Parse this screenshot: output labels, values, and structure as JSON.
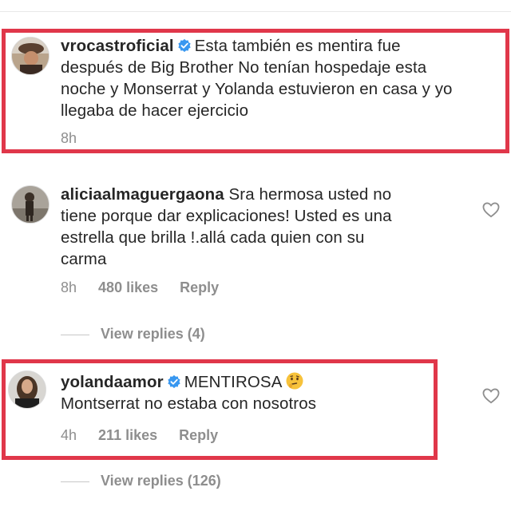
{
  "comments": [
    {
      "username": "vrocastroficial",
      "verified": true,
      "text": "Esta también es mentira fue después de Big Brother No tenían hospedaje esta noche y Monserrat y Yolanda estuvieron en casa y yo llegaba de hacer ejercicio",
      "lines": [
        "Esta también es mentira fue",
        "después de Big Brother No tenían hospedaje esta",
        "noche y Monserrat y Yolanda estuvieron en casa y yo",
        "llegaba de hacer ejercicio"
      ],
      "time": "8h",
      "highlighted": true
    },
    {
      "username": "aliciaalmaguergaona",
      "verified": false,
      "lines": [
        "Sra hermosa usted no",
        "tiene porque dar explicaciones! Usted es una",
        "estrella que brilla !.allá cada quien con su",
        "carma"
      ],
      "time": "8h",
      "likes": "480 likes",
      "reply": "Reply",
      "view_replies": "View replies (4)",
      "highlighted": false
    },
    {
      "username": "yolandaamor",
      "verified": true,
      "lines": [
        "MENTIROSA",
        "Montserrat no estaba con nosotros"
      ],
      "emoji": "thinking-face",
      "time": "4h",
      "likes": "211 likes",
      "reply": "Reply",
      "view_replies": "View replies (126)",
      "highlighted": true
    }
  ],
  "colors": {
    "highlight": "#e0374a",
    "verified": "#3897f0",
    "meta": "#8e8e8e",
    "text": "#262626"
  }
}
